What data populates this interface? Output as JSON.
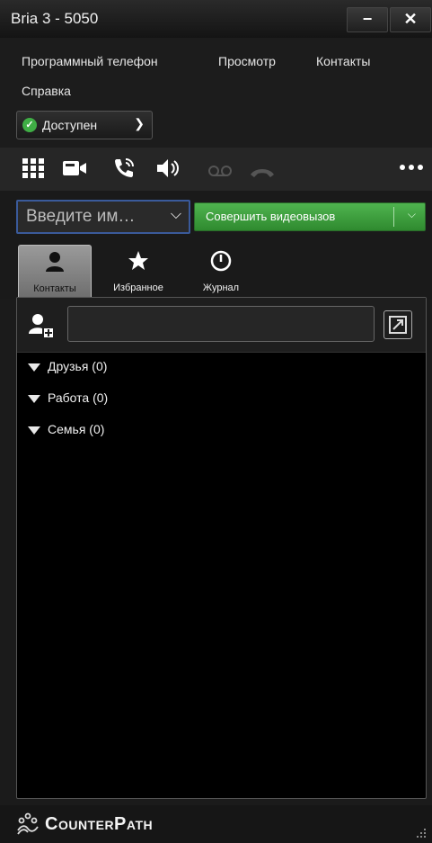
{
  "window": {
    "title": "Bria 3 - 5050",
    "minimize_label": "−",
    "close_label": "✕"
  },
  "menu": {
    "items": [
      "Программный телефон",
      "Просмотр",
      "Контакты",
      "Справка"
    ]
  },
  "status": {
    "label": "Доступен",
    "color": "#3fae45"
  },
  "toolbar": {
    "icons": [
      "dialpad-icon",
      "video-camera-icon",
      "phone-call-icon",
      "speaker-icon",
      "voicemail-icon",
      "hangup-icon",
      "more-icon"
    ]
  },
  "dial": {
    "placeholder": "Введите им…",
    "video_call_label": "Совершить видеовызов"
  },
  "tabs": [
    {
      "label": "Контакты",
      "icon": "contact-icon",
      "active": true
    },
    {
      "label": "Избранное",
      "icon": "star-icon",
      "active": false
    },
    {
      "label": "Журнал",
      "icon": "clock-icon",
      "active": false
    }
  ],
  "contacts": {
    "groups": [
      {
        "label": "Друзья (0)"
      },
      {
        "label": "Работа (0)"
      },
      {
        "label": "Семья (0)"
      }
    ]
  },
  "footer": {
    "brand": "CounterPath"
  }
}
